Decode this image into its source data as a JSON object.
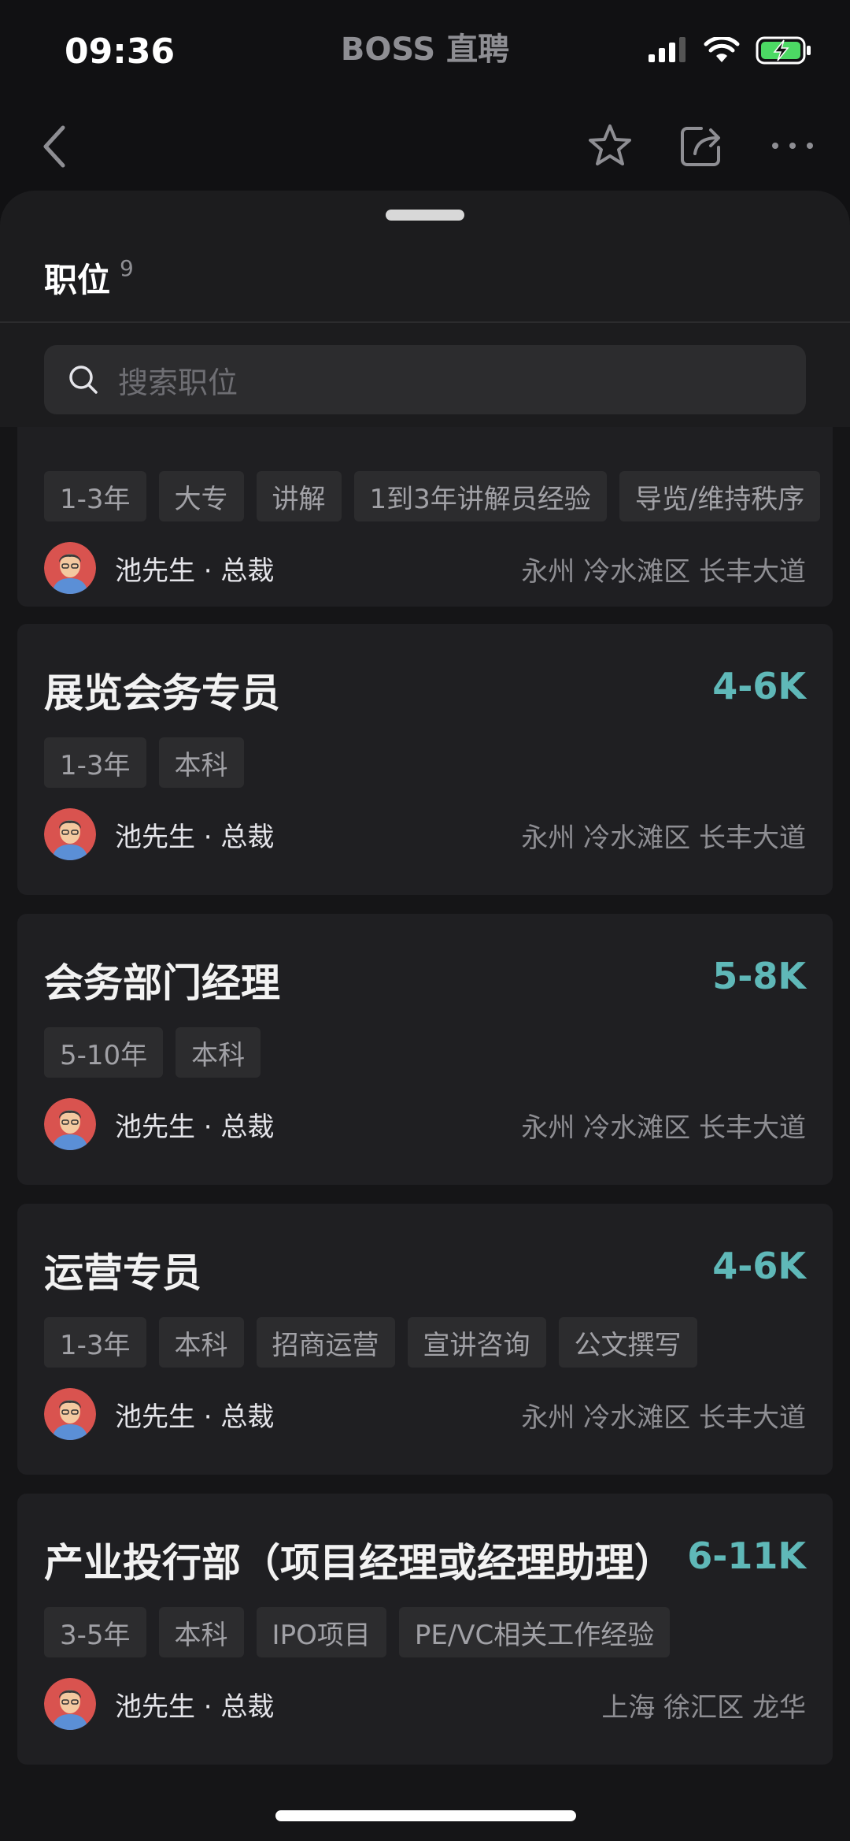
{
  "status_bar": {
    "time": "09:36",
    "app_name": "BOSS 直聘"
  },
  "nav": {
    "back_icon": "chevron-left-icon",
    "actions": [
      "star-icon",
      "share-icon",
      "more-icon"
    ]
  },
  "sheet": {
    "title": "职位",
    "count": "9",
    "search_placeholder": "搜索职位"
  },
  "jobs": [
    {
      "title": "",
      "salary": "",
      "tags": [
        "1-3年",
        "大专",
        "讲解",
        "1到3年讲解员经验",
        "导览/维持秩序"
      ],
      "recruiter": "池先生 · 总裁",
      "location": "永州 冷水滩区 长丰大道"
    },
    {
      "title": "展览会务专员",
      "salary": "4-6K",
      "tags": [
        "1-3年",
        "本科"
      ],
      "recruiter": "池先生 · 总裁",
      "location": "永州 冷水滩区 长丰大道"
    },
    {
      "title": "会务部门经理",
      "salary": "5-8K",
      "tags": [
        "5-10年",
        "本科"
      ],
      "recruiter": "池先生 · 总裁",
      "location": "永州 冷水滩区 长丰大道"
    },
    {
      "title": "运营专员",
      "salary": "4-6K",
      "tags": [
        "1-3年",
        "本科",
        "招商运营",
        "宣讲咨询",
        "公文撰写"
      ],
      "recruiter": "池先生 · 总裁",
      "location": "永州 冷水滩区 长丰大道"
    },
    {
      "title": "产业投行部（项目经理或经理助理）",
      "salary": "6-11K",
      "tags": [
        "3-5年",
        "本科",
        "IPO项目",
        "PE/VC相关工作经验"
      ],
      "recruiter": "池先生 · 总裁",
      "location": "上海 徐汇区 龙华"
    }
  ],
  "colors": {
    "salary": "#5fb8b8",
    "card_bg": "#1f1f22",
    "tag_bg": "#2c2c2e"
  }
}
